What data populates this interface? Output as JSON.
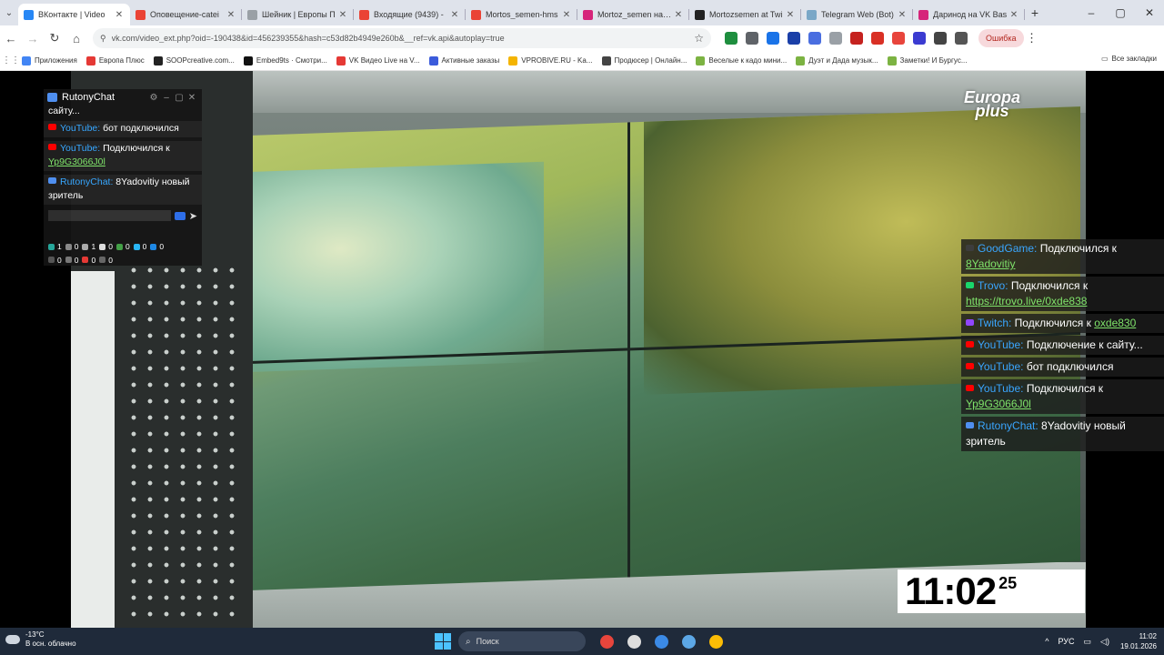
{
  "browser": {
    "tabs": [
      {
        "label": "ВКонтакте | Video",
        "color": "#2787f5",
        "active": true
      },
      {
        "label": "Оповещение-catei",
        "color": "#ea4335"
      },
      {
        "label": "Шейник | Европы П",
        "color": "#9aa0a6"
      },
      {
        "label": "Входящие (9439) -",
        "color": "#ea4335"
      },
      {
        "label": "Mortos_semen-hms",
        "color": "#ea4335"
      },
      {
        "label": "Mortoz_semen на VK",
        "color": "#d6247a"
      },
      {
        "label": "Mortozsemen at Twi",
        "color": "#222222"
      },
      {
        "label": "Telegram Web (Bot)",
        "color": "#7aa7c7"
      },
      {
        "label": "Даринод на VK Bas",
        "color": "#d6247a"
      }
    ],
    "new_tab": "+",
    "address": "vk.com/video_ext.php?oid=-190438&id=456239355&hash=c53d82b4949e260b&__ref=vk.api&autoplay=true",
    "error_pill": "Ошибка",
    "extensions": [
      "#1e8e3e",
      "#5f6368",
      "#1a73e8",
      "#1a3fa8",
      "#4a6ee0",
      "#9aa0a6",
      "#c5221f",
      "#d93025",
      "#e8453c",
      "#3b3bd1",
      "#444444",
      "#555555"
    ],
    "bookmarks": [
      {
        "label": "Приложения",
        "color": "#4285f4"
      },
      {
        "label": "Европа Плюс",
        "color": "#e53935"
      },
      {
        "label": "SOOPcreative.com...",
        "color": "#222222"
      },
      {
        "label": "Embed9ts · Смотри...",
        "color": "#111111"
      },
      {
        "label": "VK Видео Live на V...",
        "color": "#e53935"
      },
      {
        "label": "Активные заказы",
        "color": "#3b5bdb"
      },
      {
        "label": "VPROBIVE.RU - Ka...",
        "color": "#f4b400"
      },
      {
        "label": "Продюсер | Онлайн...",
        "color": "#444444"
      },
      {
        "label": "Веселые к кадо мини...",
        "color": "#7cb342"
      },
      {
        "label": "Дуэт и Дада музык...",
        "color": "#7cb342"
      },
      {
        "label": "Заметки! И Бургус...",
        "color": "#7cb342"
      }
    ],
    "all_bookmarks": "Все закладки"
  },
  "video": {
    "channel_logo_line1": "Europa",
    "channel_logo_line2": "plus"
  },
  "chat_widget": {
    "title": "RutonyChat",
    "truncated_line": "сайту...",
    "messages": [
      {
        "source": "YouTube:",
        "color": "#ff0000",
        "text": " бот подключился",
        "link": ""
      },
      {
        "source": "YouTube:",
        "color": "#ff0000",
        "text": " Подключился к",
        "link": "Yp9G3066J0l"
      },
      {
        "source": "RutonyChat:",
        "color": "#4f8ff0",
        "text": " 8Yadovitiy новый зритель",
        "link": ""
      }
    ],
    "stats": [
      {
        "value": "1",
        "color": "#26a69a"
      },
      {
        "value": "0",
        "color": "#888888"
      },
      {
        "value": "1",
        "color": "#aaaaaa"
      },
      {
        "value": "0",
        "color": "#dddddd"
      },
      {
        "value": "0",
        "color": "#43a047"
      },
      {
        "value": "0",
        "color": "#29b6f6"
      },
      {
        "value": "0",
        "color": "#1e88e5"
      },
      {
        "value": "0",
        "color": "#555555"
      },
      {
        "value": "0",
        "color": "#777777"
      },
      {
        "value": "0",
        "color": "#e53935"
      },
      {
        "value": "0",
        "color": "#666666"
      }
    ]
  },
  "chat_overlay": {
    "messages": [
      {
        "source": "GoodGame:",
        "color": "#3d3d3d",
        "text": " Подключился к",
        "link": "8Yadovitiy"
      },
      {
        "source": "Trovo:",
        "color": "#19d66b",
        "text": " Подключился к",
        "link": "https://trovo.live/0xde838"
      },
      {
        "source": "Twitch:",
        "color": "#9146ff",
        "text": " Подключился к ",
        "link": "oxde830"
      },
      {
        "source": "YouTube:",
        "color": "#ff0000",
        "text": " Подключение к сайту...",
        "link": ""
      },
      {
        "source": "YouTube:",
        "color": "#ff0000",
        "text": " бот подключился",
        "link": ""
      },
      {
        "source": "YouTube:",
        "color": "#ff0000",
        "text": " Подключился к",
        "link": "Yp9G3066J0l"
      },
      {
        "source": "RutonyChat:",
        "color": "#4f8ff0",
        "text": " 8Yadovitiy новый зритель",
        "link": ""
      }
    ]
  },
  "clock": {
    "hours_minutes": "11:02",
    "seconds": "25"
  },
  "taskbar": {
    "weather_temp": "-13°C",
    "weather_desc": "В осн. облачно",
    "search_placeholder": "Поиск",
    "apps": [
      "#e8453c",
      "#dddddd",
      "#3b8ae6",
      "#5ca7e6",
      "#fbbc05"
    ],
    "language": "РУС",
    "time": "11:02",
    "date": "19.01.2026"
  }
}
